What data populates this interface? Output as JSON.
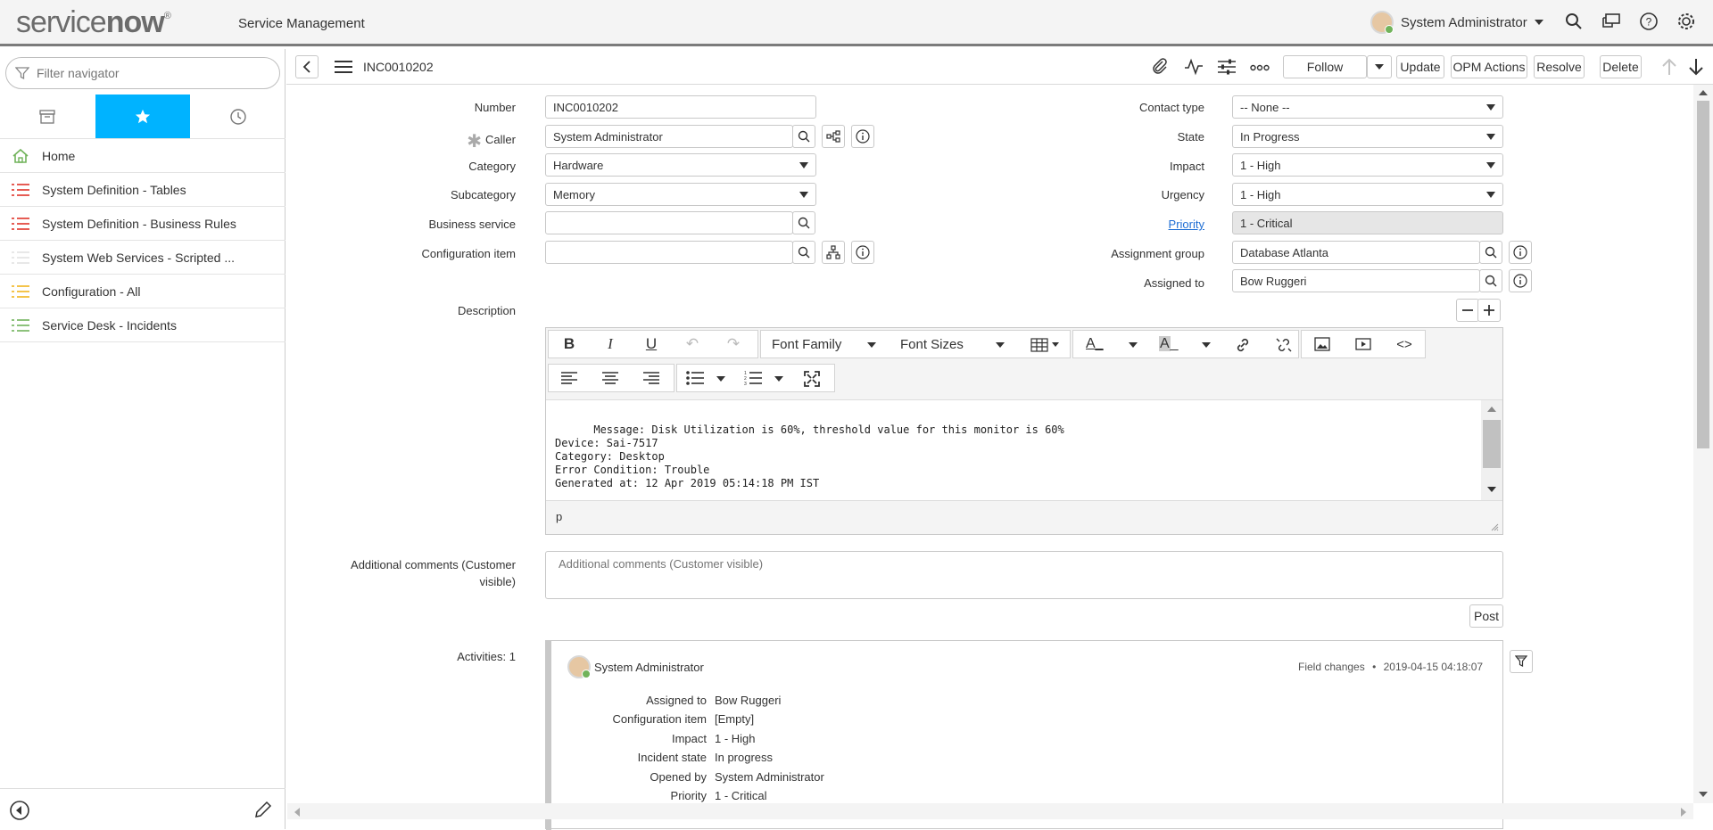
{
  "header": {
    "logo_service": "service",
    "logo_now": "now",
    "logo_reg": "®",
    "app_title": "Service Management",
    "user_name": "System Administrator"
  },
  "nav": {
    "filter_placeholder": "Filter navigator",
    "items": [
      {
        "label": "Home",
        "icon": "home-icon",
        "color": "#71b35b"
      },
      {
        "label": "System Definition - Tables",
        "icon": "list-icon",
        "color": "#e0342a"
      },
      {
        "label": "System Definition - Business Rules",
        "icon": "list-icon",
        "color": "#e0342a"
      },
      {
        "label": "System Web Services - Scripted ...",
        "icon": "list-icon",
        "color": "#dddddd"
      },
      {
        "label": "Configuration - All",
        "icon": "list-icon",
        "color": "#f2b51e"
      },
      {
        "label": "Service Desk - Incidents",
        "icon": "list-icon",
        "color": "#71b35b"
      }
    ]
  },
  "form_header": {
    "number": "INC0010202",
    "follow": "Follow",
    "update": "Update",
    "opm_actions": "OPM Actions",
    "resolve": "Resolve",
    "delete": "Delete"
  },
  "form": {
    "number_label": "Number",
    "number_value": "INC0010202",
    "caller_label": "Caller",
    "caller_value": "System Administrator",
    "category_label": "Category",
    "category_value": "Hardware",
    "subcategory_label": "Subcategory",
    "subcategory_value": "Memory",
    "business_service_label": "Business service",
    "business_service_value": "",
    "config_item_label": "Configuration item",
    "config_item_value": "",
    "contact_type_label": "Contact type",
    "contact_type_value": "-- None --",
    "state_label": "State",
    "state_value": "In Progress",
    "impact_label": "Impact",
    "impact_value": "1 - High",
    "urgency_label": "Urgency",
    "urgency_value": "1 - High",
    "priority_label": "Priority",
    "priority_value": "1 - Critical",
    "assignment_group_label": "Assignment group",
    "assignment_group_value": "Database Atlanta",
    "assigned_to_label": "Assigned to",
    "assigned_to_value": "Bow Ruggeri",
    "description_label": "Description",
    "additional_comments_label": "Additional comments (Customer visible)",
    "additional_comments_placeholder": "Additional comments (Customer visible)",
    "post": "Post",
    "activities_label": "Activities: 1"
  },
  "editor": {
    "font_family": "Font Family",
    "font_sizes": "Font Sizes",
    "content": "Message: Disk Utilization is 60%, threshold value for this monitor is 60%\nDevice: Sai-7517\nCategory: Desktop\nError Condition: Trouble\nGenerated at: 12 Apr 2019 05:14:18 PM IST",
    "status_path": "p"
  },
  "activity": {
    "user": "System Administrator",
    "type": "Field changes",
    "separator": "•",
    "timestamp": "2019-04-15 04:18:07",
    "changes": [
      {
        "field": "Assigned to",
        "value": "Bow Ruggeri"
      },
      {
        "field": "Configuration item",
        "value": "[Empty]"
      },
      {
        "field": "Impact",
        "value": "1 - High"
      },
      {
        "field": "Incident state",
        "value": "In progress"
      },
      {
        "field": "Opened by",
        "value": "System Administrator"
      },
      {
        "field": "Priority",
        "value": "1 - Critical"
      }
    ]
  }
}
